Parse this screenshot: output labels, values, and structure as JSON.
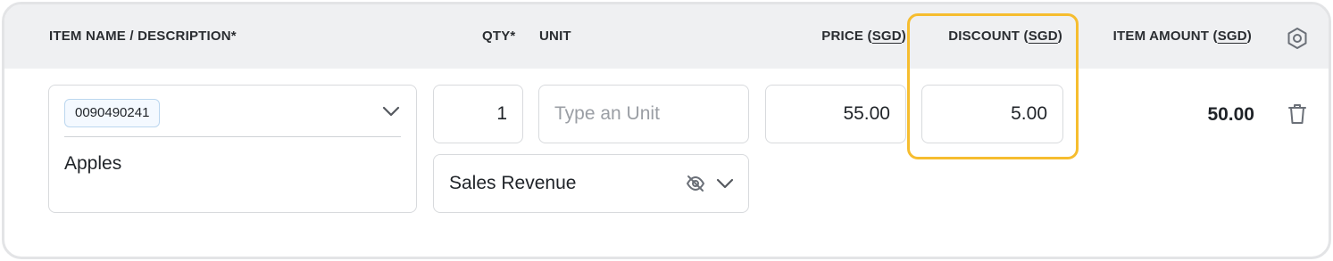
{
  "header": {
    "item_name": "ITEM NAME / DESCRIPTION*",
    "qty": "QTY*",
    "unit": "UNIT",
    "price_prefix": "PRICE (",
    "discount_prefix": "DISCOUNT (",
    "item_amount_prefix": "ITEM AMOUNT (",
    "currency": "SGD",
    "suffix": ")"
  },
  "row": {
    "item_code": "0090490241",
    "item_description": "Apples",
    "qty": "1",
    "unit_value": "",
    "unit_placeholder": "Type an Unit",
    "price": "55.00",
    "discount": "5.00",
    "account": "Sales Revenue",
    "item_amount": "50.00"
  },
  "icons": {
    "settings": "hexagon-settings-icon",
    "item_dropdown": "chevron-down-icon",
    "account_visibility": "eye-off-icon",
    "account_dropdown": "chevron-down-icon",
    "delete": "trash-icon"
  },
  "colors": {
    "highlight": "#f6bd2f",
    "header_bg": "#eff0f2",
    "chip_border": "#bcd7ef"
  }
}
